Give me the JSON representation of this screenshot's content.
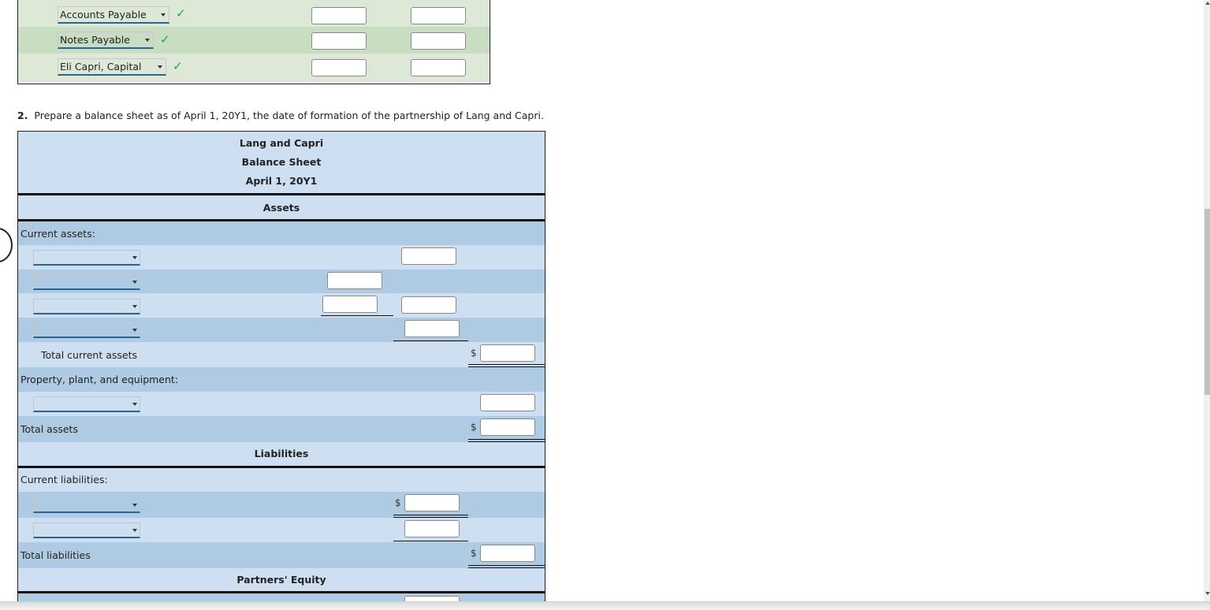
{
  "top_table": {
    "rows": [
      {
        "account": "Accounts Payable",
        "status": "correct"
      },
      {
        "account": "Notes Payable",
        "status": "correct"
      },
      {
        "account": "Eli Capri, Capital",
        "status": "correct"
      }
    ],
    "check_glyph": "✓",
    "check_color": "#2e9e3a"
  },
  "instruction": {
    "number": "2.",
    "text": "Prepare a balance sheet as of April 1, 20Y1, the date of formation of the partnership of Lang and Capri."
  },
  "balance_sheet": {
    "company": "Lang and Capri",
    "title": "Balance Sheet",
    "date": "April 1, 20Y1",
    "sections": {
      "assets": "Assets",
      "liabilities": "Liabilities",
      "equity": "Partners' Equity"
    },
    "labels": {
      "current_assets": "Current assets:",
      "total_current_assets": "Total current assets",
      "ppe": "Property, plant, and equipment:",
      "total_assets": "Total assets",
      "current_liabilities": "Current liabilities:",
      "total_liabilities": "Total liabilities"
    },
    "currency_symbol": "$",
    "select_value": "",
    "input_value": ""
  },
  "colors": {
    "green_light": "#dde9d6",
    "green_dark": "#c8ddc1",
    "blue_light": "#cddff0",
    "blue_dark": "#afcbe3",
    "select_underline": "#2a6496"
  }
}
